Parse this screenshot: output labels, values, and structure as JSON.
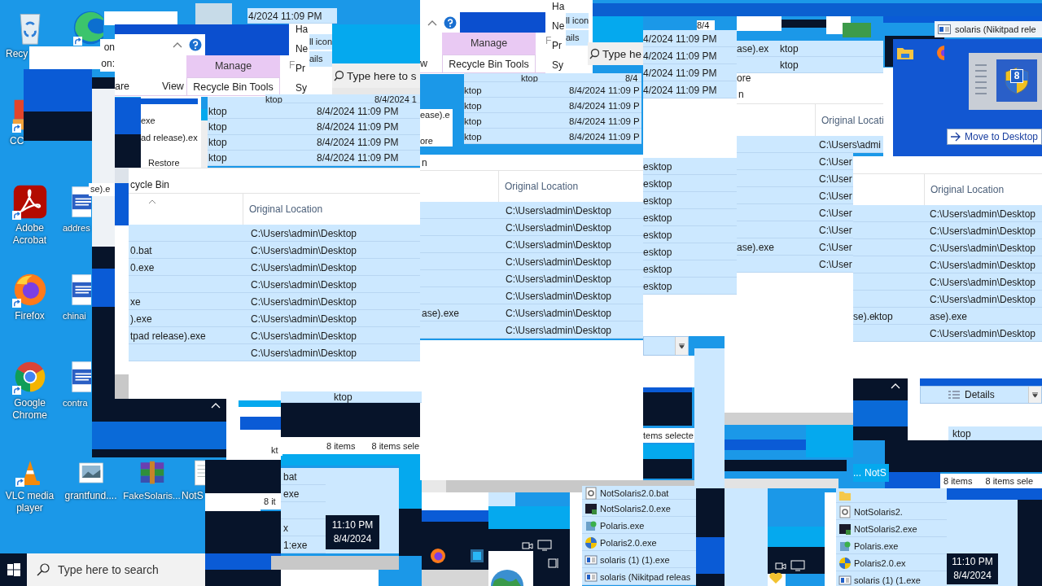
{
  "desktop_icons": [
    {
      "kind": "recycle_bin",
      "label": "Recy",
      "shortcut": false
    },
    {
      "kind": "edge",
      "shortcut": true
    },
    {
      "kind": "ccleaner",
      "label": "CC",
      "shortcut": true
    },
    {
      "kind": "acrobat",
      "label": "Adobe Acrobat",
      "shortcut": true
    },
    {
      "kind": "word",
      "label": "addres",
      "shortcut": false
    },
    {
      "kind": "firefox",
      "label": "Firefox",
      "shortcut": true
    },
    {
      "kind": "word",
      "label": "chinai",
      "shortcut": false
    },
    {
      "kind": "chrome",
      "label": "Google Chrome",
      "shortcut": true
    },
    {
      "kind": "word",
      "label": "contra",
      "shortcut": false
    },
    {
      "kind": "vlc",
      "label": "VLC media player",
      "shortcut": true
    },
    {
      "kind": "image",
      "label": "grantfund....",
      "shortcut": false
    },
    {
      "kind": "archive",
      "label": "FakeSolaris...",
      "shortcut": false
    },
    {
      "kind": "script",
      "label": "NotS",
      "shortcut": false
    }
  ],
  "windows": [
    {
      "kind": "labels",
      "items": [
        "on",
        "on:"
      ]
    },
    {
      "kind": "ribbon",
      "group_label": "Manage",
      "tabs": [
        {
          "label": "are",
          "selected": false
        },
        {
          "label": "View",
          "selected": false
        },
        {
          "label": "Recycle Bin Tools",
          "selected": true
        }
      ]
    },
    {
      "kind": "rows",
      "rows": [
        {
          "date": "4/2024 11:09 PM",
          "selected": true
        }
      ]
    },
    {
      "kind": "view_options",
      "hint": "F",
      "items": [
        "Ha",
        "Ne",
        "Pr",
        "Sy"
      ],
      "side_items": [
        "ll icon",
        "ails"
      ]
    },
    {
      "kind": "search",
      "placeholder": "Type here to s"
    },
    {
      "kind": "rows",
      "rows": [
        {
          "location": "ktop",
          "date": "8/4/2024 1",
          "selected": true
        }
      ]
    },
    {
      "kind": "labels",
      "items": [
        "exe",
        "ad release).ex",
        "Restore"
      ]
    },
    {
      "kind": "rows",
      "rows": [
        {
          "location": "ktop",
          "date": "8/4/2024 11:09 PM",
          "selected": true
        },
        {
          "location": "ktop",
          "date": "8/4/2024 11:09 PM",
          "selected": true
        },
        {
          "location": "ktop",
          "date": "8/4/2024 11:09 PM",
          "selected": true
        },
        {
          "location": "ktop",
          "date": "8/4/2024 11:09 PM",
          "selected": true
        }
      ]
    },
    {
      "kind": "labels",
      "items": [
        "se).e"
      ]
    },
    {
      "kind": "details",
      "address": "cycle Bin",
      "header": {
        "location": "Original Location",
        "name_sorted": true
      },
      "rows": [
        {
          "location": "C:\\Users\\admin\\Desktop",
          "selected": true
        },
        {
          "name": "0.bat",
          "location": "C:\\Users\\admin\\Desktop",
          "selected": true
        },
        {
          "name": "0.exe",
          "location": "C:\\Users\\admin\\Desktop",
          "selected": true
        },
        {
          "location": "C:\\Users\\admin\\Desktop",
          "selected": true
        },
        {
          "name": "xe",
          "location": "C:\\Users\\admin\\Desktop",
          "selected": true
        },
        {
          "name": ").exe",
          "location": "C:\\Users\\admin\\Desktop",
          "selected": true
        },
        {
          "name": "tpad release).exe",
          "location": "C:\\Users\\admin\\Desktop",
          "selected": true
        },
        {
          "location": "C:\\Users\\admin\\Desktop",
          "selected": true
        }
      ]
    },
    {
      "kind": "ribbon",
      "group_label": "Manage",
      "tabs": [
        {
          "label": "w",
          "selected": false
        },
        {
          "label": "Recycle Bin Tools",
          "selected": true
        }
      ]
    },
    {
      "kind": "view_options",
      "hint": "F",
      "items": [
        "Ha",
        "Ne",
        "Pr",
        "Sy"
      ],
      "side_items": [
        "ll icon",
        "ails"
      ]
    },
    {
      "kind": "search",
      "placeholder": "Type he"
    },
    {
      "kind": "rows",
      "rows": [
        {
          "location": "ktop",
          "date": "8/4",
          "selected": true
        }
      ]
    },
    {
      "kind": "labels",
      "items": [
        "ease).e",
        "ore"
      ]
    },
    {
      "kind": "rows",
      "rows": [
        {
          "location": "ktop",
          "date": "8/4/2024 11:09 P",
          "selected": true
        },
        {
          "location": "ktop",
          "date": "8/4/2024 11:09 P",
          "selected": true
        },
        {
          "location": "ktop",
          "date": "8/4/2024 11:09 P",
          "selected": true
        },
        {
          "location": "ktop",
          "date": "8/4/2024 11:09 P",
          "selected": true
        }
      ]
    },
    {
      "kind": "details",
      "address": "n",
      "header": {
        "location": "Original Location",
        "name_sorted": false
      },
      "rows": [
        {
          "location": "C:\\Users\\admin\\Desktop",
          "selected": true
        },
        {
          "location": "C:\\Users\\admin\\Desktop",
          "selected": true
        },
        {
          "location": "C:\\Users\\admin\\Desktop",
          "selected": true
        },
        {
          "location": "C:\\Users\\admin\\Desktop",
          "selected": true
        },
        {
          "location": "C:\\Users\\admin\\Desktop",
          "selected": true
        },
        {
          "location": "C:\\Users\\admin\\Desktop",
          "selected": true
        },
        {
          "name": "ase).exe",
          "location": "C:\\Users\\admin\\Desktop",
          "selected": true
        },
        {
          "location": "C:\\Users\\admin\\Desktop",
          "selected": true
        }
      ]
    },
    {
      "kind": "labels",
      "items": [
        "8/4"
      ]
    },
    {
      "kind": "rows",
      "rows": [
        {
          "date": "4/2024 11:09 PM",
          "selected": true
        },
        {
          "date": "4/2024 11:09 PM",
          "selected": true
        },
        {
          "date": "4/2024 11:09 PM",
          "selected": true
        },
        {
          "date": "4/2024 11:09 PM",
          "selected": true
        }
      ]
    },
    {
      "kind": "rows",
      "rows": [
        {
          "location": "esktop",
          "selected": true
        },
        {
          "location": "esktop",
          "selected": true
        },
        {
          "location": "esktop",
          "selected": true
        },
        {
          "location": "esktop",
          "selected": true
        },
        {
          "location": "esktop",
          "selected": true
        },
        {
          "location": "esktop",
          "selected": true
        },
        {
          "location": "esktop",
          "selected": true
        },
        {
          "location": "esktop",
          "selected": true
        }
      ]
    },
    {
      "kind": "rows",
      "rows": [
        {
          "name": "ase).ex",
          "location": "ktop",
          "selected": true
        },
        {
          "location": "ktop",
          "selected": true
        }
      ]
    },
    {
      "kind": "labels",
      "items": [
        "ore"
      ]
    },
    {
      "kind": "details",
      "address": "n",
      "header": {
        "location": "Original Locati",
        "name_sorted": false
      },
      "rows": [
        {
          "location": "C:\\Users\\admi",
          "selected": true
        },
        {
          "location": "C:\\User",
          "selected": true
        },
        {
          "location": "C:\\User",
          "selected": true
        },
        {
          "location": "C:\\User",
          "selected": true
        },
        {
          "location": "C:\\User",
          "selected": true
        },
        {
          "location": "C:\\User",
          "selected": true
        },
        {
          "name": "ase).exe",
          "location": "C:\\User",
          "selected": true
        },
        {
          "location": "C:\\User",
          "selected": true
        }
      ]
    },
    {
      "kind": "window_title",
      "title": "solaris (Nikitpad rele"
    },
    {
      "kind": "drag_preview",
      "badge": "8",
      "tooltip": "Move to Desktop"
    },
    {
      "kind": "dropdown"
    },
    {
      "kind": "details",
      "header": {
        "location": "Original Location",
        "name_sorted": false
      },
      "rows": [
        {
          "location": "C:\\Users\\admin\\Desktop",
          "selected": true
        },
        {
          "location": "C:\\Users\\admin\\Desktop",
          "selected": true
        },
        {
          "location": "C:\\Users\\admin\\Desktop",
          "selected": true
        },
        {
          "location": "C:\\Users\\admin\\Desktop",
          "selected": true
        },
        {
          "location": "C:\\Users\\admin\\Desktop",
          "selected": true
        },
        {
          "location": "C:\\Users\\admin\\Desktop",
          "selected": true
        },
        {
          "name": "se).e",
          "note": "ktop",
          "location": "ase).exe",
          "selected": true
        },
        {
          "location": "C:\\Users\\admin\\Desktop",
          "selected": true
        }
      ]
    },
    {
      "kind": "rows",
      "rows": [
        {
          "location": "ktop",
          "selected": true
        }
      ]
    },
    {
      "kind": "labels",
      "items": [
        "kt"
      ]
    },
    {
      "kind": "status",
      "items": [
        "8 items",
        "8 items sele"
      ]
    },
    {
      "kind": "status",
      "items": [
        "tems selecte"
      ]
    },
    {
      "kind": "status",
      "items": [
        "8 it"
      ]
    },
    {
      "kind": "rows",
      "rows": [
        {
          "name": "bat",
          "selected": true
        },
        {
          "name": "exe",
          "selected": true
        },
        {
          "selected": true
        },
        {
          "name": "x",
          "selected": true
        },
        {
          "name": "1:exe",
          "selected": true
        }
      ]
    },
    {
      "kind": "clock",
      "time": "11:10 PM",
      "date": "8/4/2024"
    },
    {
      "kind": "file_list",
      "rows": [
        {
          "kind": "bat",
          "name": "NotSolaris2.0.bat",
          "selected": true
        },
        {
          "kind": "exe",
          "name": "NotSolaris2.0.exe",
          "selected": true
        },
        {
          "kind": "app",
          "name": "Polaris.exe",
          "selected": true
        },
        {
          "kind": "setup",
          "name": "Polaris2.0.exe",
          "selected": true
        },
        {
          "kind": "window",
          "name": "solaris (1) (1).exe",
          "selected": true
        },
        {
          "kind": "window",
          "name": "solaris (Nikitpad releas",
          "selected": true
        }
      ]
    },
    {
      "kind": "labels",
      "items": [
        "...",
        "NotS"
      ]
    },
    {
      "kind": "dropdown",
      "value": "Details"
    },
    {
      "kind": "rows",
      "rows": [
        {
          "location": "ktop",
          "selected": true
        }
      ]
    },
    {
      "kind": "status",
      "items": [
        "8 items",
        "8 items sele"
      ]
    },
    {
      "kind": "file_list",
      "rows": [
        {
          "kind": "folder",
          "selected": true
        },
        {
          "kind": "bat",
          "name": "NotSolaris2.",
          "selected": true
        },
        {
          "kind": "exe",
          "name": "NotSolaris2.exe",
          "selected": true
        },
        {
          "kind": "app",
          "name": "Polaris.exe",
          "selected": true
        },
        {
          "kind": "setup",
          "name": "Polaris2.0.ex",
          "selected": true
        },
        {
          "kind": "window",
          "name": "solaris (1) (1.exe",
          "selected": true
        }
      ]
    },
    {
      "kind": "clock",
      "time": "11:10 PM",
      "date": "8/4/2024"
    }
  ],
  "taskbar": {
    "search": {
      "placeholder": "Type here to search"
    }
  }
}
